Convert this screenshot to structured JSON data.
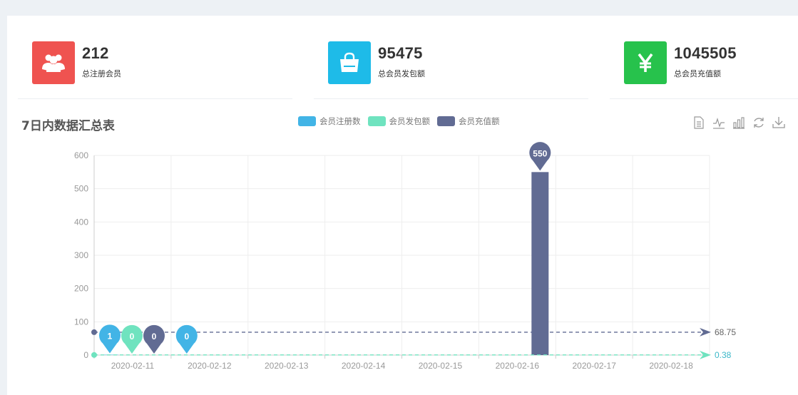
{
  "stats": [
    {
      "value": "212",
      "label": "总注册会员",
      "color": "#ef5350",
      "icon": "users-icon"
    },
    {
      "value": "95475",
      "label": "总会员发包额",
      "color": "#1ebbe8",
      "icon": "shopping-bag-icon"
    },
    {
      "value": "1045505",
      "label": "总会员充值额",
      "color": "#27c24c",
      "icon": "yen-icon"
    }
  ],
  "chart_title": "7日内数据汇总表",
  "toolbox": [
    "data-view-icon",
    "line-chart-icon",
    "bar-chart-icon",
    "restore-icon",
    "download-icon"
  ],
  "chart_data": {
    "type": "bar",
    "categories": [
      "2020-02-11",
      "2020-02-12",
      "2020-02-13",
      "2020-02-14",
      "2020-02-15",
      "2020-02-16",
      "2020-02-17",
      "2020-02-18"
    ],
    "ylim": [
      0,
      600
    ],
    "yticks": [
      0,
      100,
      200,
      300,
      400,
      500,
      600
    ],
    "grid": true,
    "legend_placement": "top-center",
    "series": [
      {
        "name": "会员注册数",
        "color": "#42b4e6",
        "values": [
          1,
          0,
          0,
          0,
          0,
          0,
          0,
          0
        ],
        "markline": 0.38,
        "markline_label": "0.38"
      },
      {
        "name": "会员发包额",
        "color": "#6fe3bf",
        "values": [
          0,
          0,
          0,
          0,
          0,
          0,
          0,
          0
        ]
      },
      {
        "name": "会员充值额",
        "color": "#616b93",
        "values": [
          0,
          0,
          0,
          0,
          0,
          550,
          0,
          0
        ],
        "markline": 68.75,
        "markline_label": "68.75"
      }
    ],
    "markpoints": [
      {
        "label": "1",
        "series": 0,
        "category": 0
      },
      {
        "label": "0",
        "series": 1,
        "category": 0
      },
      {
        "label": "0",
        "series": 2,
        "category": 0
      },
      {
        "label": "0",
        "series": 0,
        "category": 1
      },
      {
        "label": "550",
        "series": 2,
        "category": 5
      }
    ]
  }
}
